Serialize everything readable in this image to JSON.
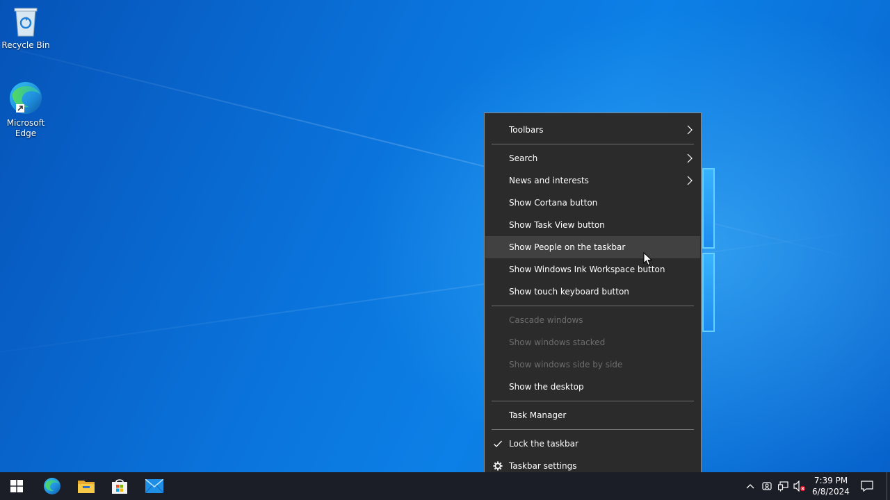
{
  "desktop": {
    "icons": [
      {
        "label": "Recycle Bin",
        "icon": "recycle-bin-icon"
      },
      {
        "label": "Microsoft Edge",
        "icon": "edge-icon"
      }
    ]
  },
  "context_menu": {
    "items": {
      "toolbars": "Toolbars",
      "search": "Search",
      "news": "News and interests",
      "cortana": "Show Cortana button",
      "task_view": "Show Task View button",
      "people": "Show People on the taskbar",
      "ink": "Show Windows Ink Workspace button",
      "touch_keyboard": "Show touch keyboard button",
      "cascade": "Cascade windows",
      "stacked": "Show windows stacked",
      "side_by_side": "Show windows side by side",
      "show_desktop": "Show the desktop",
      "task_manager": "Task Manager",
      "lock": "Lock the taskbar",
      "settings": "Taskbar settings"
    },
    "hovered_item": "Show People on the taskbar",
    "checked_item": "Lock the taskbar",
    "disabled_items": [
      "Cascade windows",
      "Show windows stacked",
      "Show windows side by side"
    ]
  },
  "taskbar": {
    "pinned": [
      "start-icon",
      "edge-icon",
      "file-explorer-icon",
      "store-icon",
      "mail-icon"
    ],
    "tray": [
      "chevron-up-icon",
      "meet-now-icon",
      "network-icon",
      "volume-muted-icon"
    ],
    "clock": {
      "time": "7:39 PM",
      "date": "6/8/2024"
    }
  },
  "colors": {
    "menu_bg": "#2b2b2b",
    "menu_hover": "#414141",
    "menu_disabled_text": "#6d6d6d",
    "taskbar_bg": "#1b1d27"
  }
}
